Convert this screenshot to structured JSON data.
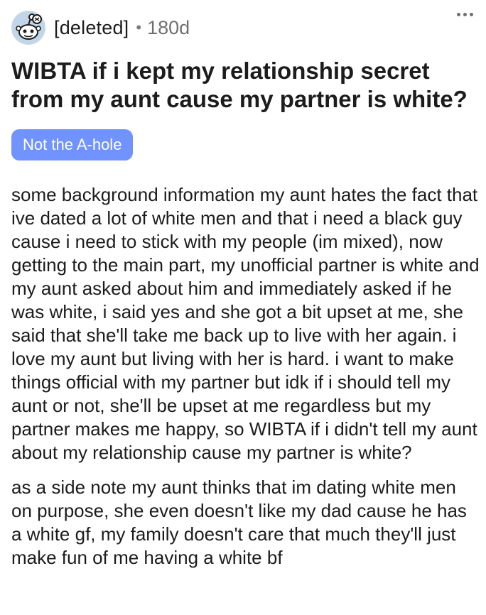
{
  "post": {
    "author": "[deleted]",
    "separator": "•",
    "age": "180d",
    "title": "WIBTA if i kept my relationship secret from my aunt cause my partner is white?",
    "flair": "Not the A-hole",
    "paragraphs": [
      "some background information my aunt hates the fact that ive dated a lot of white men and that i need a black guy cause i need to stick with my people (im mixed), now getting to the main part, my unofficial partner is white and my aunt asked about him and immediately asked if he was white, i said yes and she got a bit upset at me, she said that she'll take me back up to live with her again. i love my aunt but living with her is hard. i want to make things official with my partner but idk if i should tell my aunt or not, she'll be upset at me regardless but my partner makes me happy, so WIBTA if i didn't tell my aunt about my relationship cause my partner is white?",
      "as a side note my aunt thinks that im dating white men on purpose, she even doesn't like my dad cause he has a white gf, my family doesn't care that much they'll just make fun of me having a white bf"
    ]
  },
  "icons": {
    "avatar": "reddit-snoo-avatar-icon",
    "more": "more-options-icon"
  },
  "colors": {
    "flair_bg": "#7193ff",
    "avatar_bg": "#c2d6e8",
    "text": "#1c1c1c",
    "meta": "#6f6f6f"
  }
}
